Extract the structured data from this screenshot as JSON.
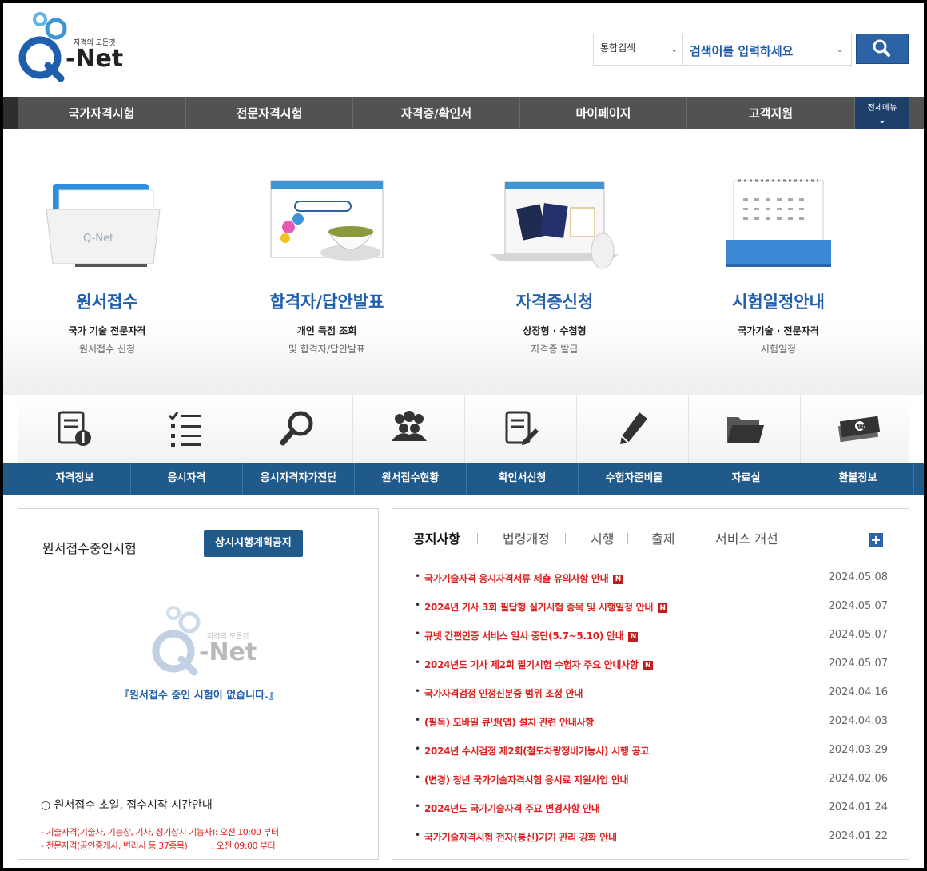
{
  "header": {
    "logo_tagline": "자격의 모든것",
    "logo_text": "-Net",
    "search_scope": "통합검색",
    "search_placeholder": "검색어를 입력하세요"
  },
  "gnb": {
    "items": [
      "국가자격시험",
      "전문자격시험",
      "자격증/확인서",
      "마이페이지",
      "고객지원"
    ],
    "all_menu": "전체메뉴"
  },
  "hero": [
    {
      "title": "원서접수",
      "sub1": "국가 기술 전문자격",
      "sub2": "원서접수 신청"
    },
    {
      "title": "합격자/답안발표",
      "sub1": "개인 득점 조회",
      "sub2": "및 합격자/답안발표"
    },
    {
      "title": "자격증신청",
      "sub1": "상장형 · 수첩형",
      "sub2": "자격증 발급"
    },
    {
      "title": "시험일정안내",
      "sub1": "국가기술 · 전문자격",
      "sub2": "시험일정"
    }
  ],
  "quick_menu": [
    {
      "label": "자격정보",
      "icon": "info-document-icon"
    },
    {
      "label": "응시자격",
      "icon": "checklist-icon"
    },
    {
      "label": "응시자격자가진단",
      "icon": "magnifier-icon"
    },
    {
      "label": "원서접수현황",
      "icon": "people-group-icon"
    },
    {
      "label": "확인서신청",
      "icon": "document-pen-icon"
    },
    {
      "label": "수험자준비물",
      "icon": "pencil-icon"
    },
    {
      "label": "자료실",
      "icon": "folder-icon"
    },
    {
      "label": "환불정보",
      "icon": "money-stack-icon"
    }
  ],
  "left_panel": {
    "title": "원서접수중인시험",
    "button": "상시시행계획공지",
    "empty_message": "『원서접수 중인 시험이 없습니다.』",
    "guide_title": "○ 원서접수 초일, 접수시작 시간안내",
    "guide_lines": [
      "- 기술자격(기술사, 기능장, 기사, 정기상시 기능사): 오전 10:00 부터",
      "- 전문자격(공인중개사, 변리사 등 37종목)          : 오전 09:00 부터"
    ]
  },
  "right_panel": {
    "tabs": [
      "공지사항",
      "법령개정",
      "시행",
      "출제",
      "서비스 개선"
    ],
    "more": "+",
    "notices": [
      {
        "text": "국가기술자격 응시자격서류 제출 유의사항 안내",
        "new": "N",
        "date": "2024.05.08"
      },
      {
        "text": "2024년 기사 3회 필답형 실기시험 종목 및 시행일정 안내",
        "new": "N",
        "date": "2024.05.07"
      },
      {
        "text": "큐넷 간편인증 서비스 일시 중단(5.7~5.10) 안내",
        "new": "N",
        "date": "2024.05.07"
      },
      {
        "text": "2024년도 기사 제2회 필기시험 수험자 주요 안내사항",
        "new": "N",
        "date": "2024.05.07"
      },
      {
        "text": "국가자격검정 인정신분증 범위 조정 안내",
        "new": "",
        "date": "2024.04.16"
      },
      {
        "text": "(필독) 모바일 큐넷(앱) 설치 관련 안내사항",
        "new": "",
        "date": "2024.04.03"
      },
      {
        "text": "2024년 수시검정 제2회(철도차량정비기능사) 시행 공고",
        "new": "",
        "date": "2024.03.29"
      },
      {
        "text": "(변경) 청년 국가기술자격시험 응시료 지원사업 안내",
        "new": "",
        "date": "2024.02.06"
      },
      {
        "text": "2024년도 국가기술자격 주요 변경사항 안내",
        "new": "",
        "date": "2024.01.24"
      },
      {
        "text": "국가기술자격시험 전자(통신)기기 관리 강화 안내",
        "new": "",
        "date": "2024.01.22"
      }
    ]
  }
}
